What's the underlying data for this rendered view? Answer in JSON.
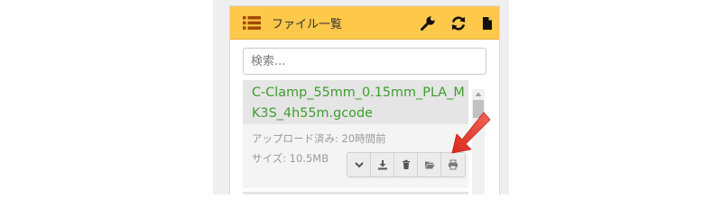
{
  "header": {
    "title": "ファイル一覧",
    "icons": [
      "list-icon",
      "wrench-icon",
      "refresh-icon",
      "new-file-icon"
    ]
  },
  "search": {
    "placeholder": "検索..."
  },
  "files": [
    {
      "name": "C-Clamp_55mm_0.15mm_PLA_MK3S_4h55m.gcode",
      "uploaded": "アップロード済み: 20時間前",
      "size": "サイズ: 10.5MB",
      "actions": [
        "chevron-down-icon",
        "download-icon",
        "trash-icon",
        "folder-open-icon",
        "print-icon"
      ]
    }
  ],
  "colors": {
    "header_bg": "#fec84b",
    "filename": "#3f9c2f",
    "arrow": "#e8392b"
  }
}
